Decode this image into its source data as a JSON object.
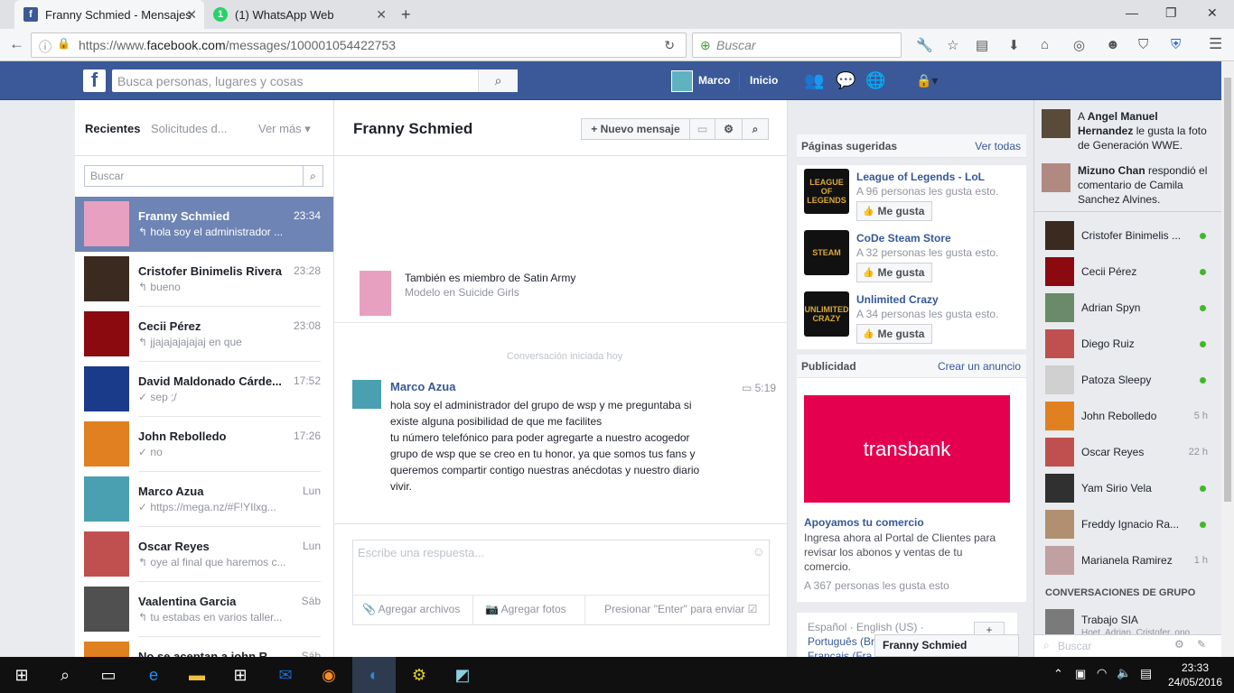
{
  "browser": {
    "tabs": [
      {
        "title": "Franny Schmied - Mensajes",
        "favicon": "f",
        "active": true
      },
      {
        "title": "(1) WhatsApp Web",
        "favicon": "1",
        "active": false
      }
    ],
    "url_prefix": "https://www.",
    "url_domain": "facebook.com",
    "url_path": "/messages/100001054422753",
    "search_placeholder": "Buscar"
  },
  "fb_header": {
    "search_placeholder": "Busca personas, lugares y cosas",
    "user_name": "Marco",
    "home_label": "Inicio"
  },
  "left": {
    "tab_recent": "Recientes",
    "tab_requests": "Solicitudes d...",
    "more": "Ver más",
    "search_placeholder": "Buscar",
    "conversations": [
      {
        "name": "Franny Schmied",
        "time": "23:34",
        "preview": "hola soy el administrador ...",
        "icon": "↰",
        "color": "#e8a0c0"
      },
      {
        "name": "Cristofer Binimelis Rivera",
        "time": "23:28",
        "preview": "bueno",
        "icon": "↰",
        "color": "#3a2a20"
      },
      {
        "name": "Cecii Pérez",
        "time": "23:08",
        "preview": "jjajajajajajaj en que",
        "icon": "↰",
        "color": "#8a0a10"
      },
      {
        "name": "David Maldonado Cárde...",
        "time": "17:52",
        "preview": "sep ;/",
        "icon": "✓",
        "color": "#1a3a8a"
      },
      {
        "name": "John Rebolledo",
        "time": "17:26",
        "preview": "no",
        "icon": "✓",
        "color": "#e08020"
      },
      {
        "name": "Marco Azua",
        "time": "Lun",
        "preview": "https://mega.nz/#F!YIlxg...",
        "icon": "✓",
        "color": "#4aa0b0"
      },
      {
        "name": "Oscar Reyes",
        "time": "Lun",
        "preview": "oye al final que haremos c...",
        "icon": "↰",
        "color": "#c05050"
      },
      {
        "name": "Vaalentina Garcia",
        "time": "Sáb",
        "preview": "tu estabas en varios taller...",
        "icon": "↰",
        "color": "#505050"
      },
      {
        "name": "No se aceptan a john Reb...",
        "time": "Sáb",
        "preview": "",
        "icon": "",
        "color": "#e08020"
      }
    ]
  },
  "conversation": {
    "title": "Franny Schmied",
    "new_message": "Nuevo mensaje",
    "profile_line1": "También es miembro de Satin Army",
    "profile_line2": "Modelo en Suicide Girls",
    "started": "Conversación iniciada hoy",
    "message": {
      "author": "Marco Azua",
      "time": "5:19",
      "lines": [
        "hola soy el administrador del grupo de wsp y me preguntaba si",
        "existe alguna posibilidad de que me facilites",
        "tu número telefónico para poder agregarte a nuestro acogedor",
        "grupo de wsp que se creo en tu honor, ya que somos tus fans y",
        "queremos compartir contigo nuestras anécdotas y nuestro diario",
        "vivir."
      ]
    },
    "reply_placeholder": "Escribe una respuesta...",
    "add_files": "Agregar archivos",
    "add_photos": "Agregar fotos",
    "enter_hint": "Presionar \"Enter\" para enviar"
  },
  "right": {
    "suggested_title": "Páginas sugeridas",
    "see_all": "Ver todas",
    "pages": [
      {
        "name": "League of Legends - LoL",
        "likes": "A 96 personas les gusta esto.",
        "logo": "LEAGUE OF LEGENDS"
      },
      {
        "name": "CoDe Steam Store",
        "likes": "A 32 personas les gusta esto.",
        "logo": "STEAM"
      },
      {
        "name": "Unlimited Crazy",
        "likes": "A 34 personas les gusta esto.",
        "logo": "UNLIMITED CRAZY"
      }
    ],
    "like_label": "Me gusta",
    "ads_title": "Publicidad",
    "create_ad": "Crear un anuncio",
    "ad_brand": "transbank",
    "ad_title": "Apoyamos tu comercio",
    "ad_text": "Ingresa ahora al Portal de Clientes para revisar los abonos y ventas de tu comercio.",
    "ad_likes": "A 367 personas les gusta esto",
    "lang_line1": "Español · English (US) ·",
    "lang_line2": "Português (Br",
    "lang_line3": "Français (Fra",
    "chat_popup": "Franny Schmied"
  },
  "chat": {
    "ticker": [
      {
        "pre": "A ",
        "bold": "Angel Manuel Hernandez",
        "rest": " le gusta la foto de Generación WWE."
      },
      {
        "pre": "",
        "bold": "Mizuno Chan",
        "rest": " respondió el comentario de Camila Sanchez Alvines."
      }
    ],
    "friends": [
      {
        "name": "Cristofer Binimelis ...",
        "status": "online",
        "time": ""
      },
      {
        "name": "Cecii Pérez",
        "status": "online",
        "time": ""
      },
      {
        "name": "Adrian Spyn",
        "status": "online",
        "time": ""
      },
      {
        "name": "Diego Ruiz",
        "status": "online",
        "time": ""
      },
      {
        "name": "Patoza Sleepy",
        "status": "online",
        "time": ""
      },
      {
        "name": "John Rebolledo",
        "status": "idle",
        "time": "5 h"
      },
      {
        "name": "Oscar Reyes",
        "status": "idle",
        "time": "22 h"
      },
      {
        "name": "Yam Sirio Vela",
        "status": "online",
        "time": ""
      },
      {
        "name": "Freddy Ignacio Ra...",
        "status": "online",
        "time": ""
      },
      {
        "name": "Marianela Ramirez",
        "status": "idle",
        "time": "1 h"
      }
    ],
    "group_title": "CONVERSACIONES DE GRUPO",
    "group_name": "Trabajo SIA",
    "group_members": "Hoet, Adrian, Cristofer, ono ...",
    "search_placeholder": "Buscar"
  },
  "taskbar": {
    "time": "23:33",
    "date": "24/05/2016"
  }
}
